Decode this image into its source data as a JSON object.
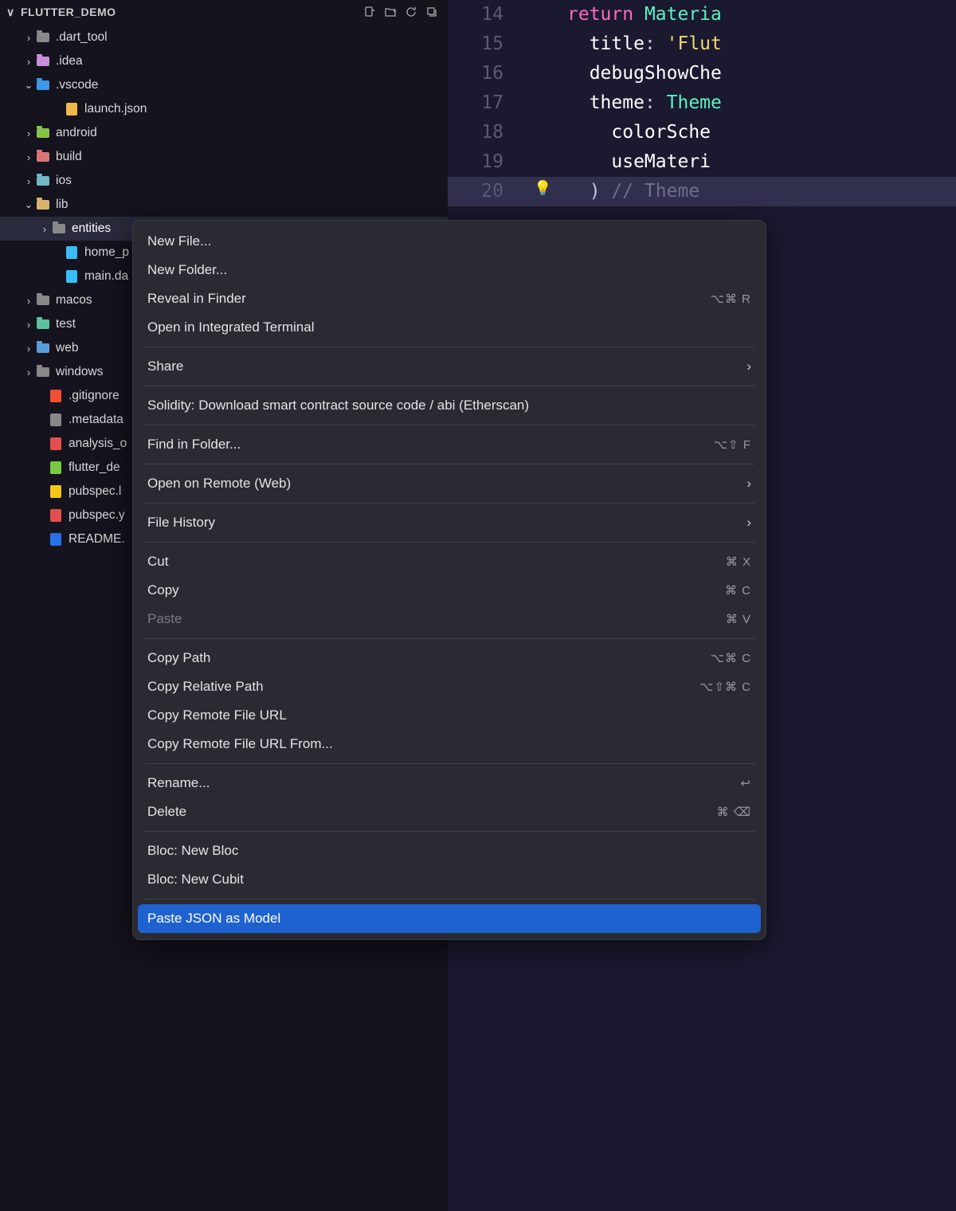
{
  "sidebar": {
    "title": "FLUTTER_DEMO",
    "tree": [
      {
        "chev": ">",
        "icon": "folder",
        "label": ".dart_tool",
        "indent": 28
      },
      {
        "chev": ">",
        "icon": "folder idea",
        "label": ".idea",
        "indent": 28
      },
      {
        "chev": "v",
        "icon": "folder vscode",
        "label": ".vscode",
        "indent": 28
      },
      {
        "chev": "",
        "icon": "file json",
        "label": "launch.json",
        "indent": 64
      },
      {
        "chev": ">",
        "icon": "folder android",
        "label": "android",
        "indent": 28
      },
      {
        "chev": ">",
        "icon": "folder build",
        "label": "build",
        "indent": 28
      },
      {
        "chev": ">",
        "icon": "folder ios",
        "label": "ios",
        "indent": 28
      },
      {
        "chev": "v",
        "icon": "folder lib",
        "label": "lib",
        "indent": 28
      },
      {
        "chev": ">",
        "icon": "folder",
        "label": "entities",
        "indent": 48,
        "selected": true
      },
      {
        "chev": "",
        "icon": "file dart",
        "label": "home_p",
        "indent": 64
      },
      {
        "chev": "",
        "icon": "file dart",
        "label": "main.da",
        "indent": 64
      },
      {
        "chev": ">",
        "icon": "folder",
        "label": "macos",
        "indent": 28
      },
      {
        "chev": ">",
        "icon": "folder test",
        "label": "test",
        "indent": 28
      },
      {
        "chev": ">",
        "icon": "folder web",
        "label": "web",
        "indent": 28
      },
      {
        "chev": ">",
        "icon": "folder",
        "label": "windows",
        "indent": 28
      },
      {
        "chev": "",
        "icon": "file git",
        "label": ".gitignore",
        "indent": 44
      },
      {
        "chev": "",
        "icon": "file gray",
        "label": ".metadata",
        "indent": 44
      },
      {
        "chev": "",
        "icon": "file yaml",
        "label": "analysis_o",
        "indent": 44
      },
      {
        "chev": "",
        "icon": "file green",
        "label": "flutter_de",
        "indent": 44
      },
      {
        "chev": "",
        "icon": "file lock",
        "label": "pubspec.l",
        "indent": 44
      },
      {
        "chev": "",
        "icon": "file yaml",
        "label": "pubspec.y",
        "indent": 44
      },
      {
        "chev": "",
        "icon": "file info",
        "label": "README.",
        "indent": 44
      }
    ]
  },
  "editor": {
    "lines": [
      {
        "num": "14",
        "tokens": [
          [
            "kw-return",
            "return "
          ],
          [
            "type",
            "Materia"
          ]
        ]
      },
      {
        "num": "15",
        "tokens": [
          [
            "prop",
            "  title"
          ],
          [
            "punct",
            ": "
          ],
          [
            "str",
            "'Flut"
          ]
        ]
      },
      {
        "num": "16",
        "tokens": [
          [
            "prop",
            "  debugShowChe"
          ]
        ]
      },
      {
        "num": "17",
        "tokens": [
          [
            "prop",
            "  theme"
          ],
          [
            "punct",
            ": "
          ],
          [
            "type",
            "Theme"
          ]
        ]
      },
      {
        "num": "18",
        "tokens": [
          [
            "prop",
            "    colorSche"
          ]
        ]
      },
      {
        "num": "19",
        "tokens": [
          [
            "prop",
            "    useMateri"
          ]
        ]
      },
      {
        "num": "20",
        "tokens": [
          [
            "punct",
            "  ) "
          ],
          [
            "comment",
            "// Theme"
          ]
        ]
      }
    ]
  },
  "menu": {
    "items": [
      {
        "type": "item",
        "label": "New File..."
      },
      {
        "type": "item",
        "label": "New Folder..."
      },
      {
        "type": "item",
        "label": "Reveal in Finder",
        "shortcut": "⌥⌘ R"
      },
      {
        "type": "item",
        "label": "Open in Integrated Terminal"
      },
      {
        "type": "sep"
      },
      {
        "type": "item",
        "label": "Share",
        "sub": "›"
      },
      {
        "type": "sep"
      },
      {
        "type": "item",
        "label": "Solidity: Download smart contract source code / abi (Etherscan)"
      },
      {
        "type": "sep"
      },
      {
        "type": "item",
        "label": "Find in Folder...",
        "shortcut": "⌥⇧ F"
      },
      {
        "type": "sep"
      },
      {
        "type": "item",
        "label": "Open on Remote (Web)",
        "sub": "›"
      },
      {
        "type": "sep"
      },
      {
        "type": "item",
        "label": "File History",
        "sub": "›"
      },
      {
        "type": "sep"
      },
      {
        "type": "item",
        "label": "Cut",
        "shortcut": "⌘ X"
      },
      {
        "type": "item",
        "label": "Copy",
        "shortcut": "⌘ C"
      },
      {
        "type": "item",
        "label": "Paste",
        "shortcut": "⌘ V",
        "disabled": true
      },
      {
        "type": "sep"
      },
      {
        "type": "item",
        "label": "Copy Path",
        "shortcut": "⌥⌘ C"
      },
      {
        "type": "item",
        "label": "Copy Relative Path",
        "shortcut": "⌥⇧⌘ C"
      },
      {
        "type": "item",
        "label": "Copy Remote File URL"
      },
      {
        "type": "item",
        "label": "Copy Remote File URL From..."
      },
      {
        "type": "sep"
      },
      {
        "type": "item",
        "label": "Rename...",
        "shortcut": "↩"
      },
      {
        "type": "item",
        "label": "Delete",
        "shortcut": "⌘ ⌫"
      },
      {
        "type": "sep"
      },
      {
        "type": "item",
        "label": "Bloc: New Bloc"
      },
      {
        "type": "item",
        "label": "Bloc: New Cubit"
      },
      {
        "type": "sep"
      },
      {
        "type": "item",
        "label": "Paste JSON as Model",
        "highlighted": true
      }
    ]
  }
}
